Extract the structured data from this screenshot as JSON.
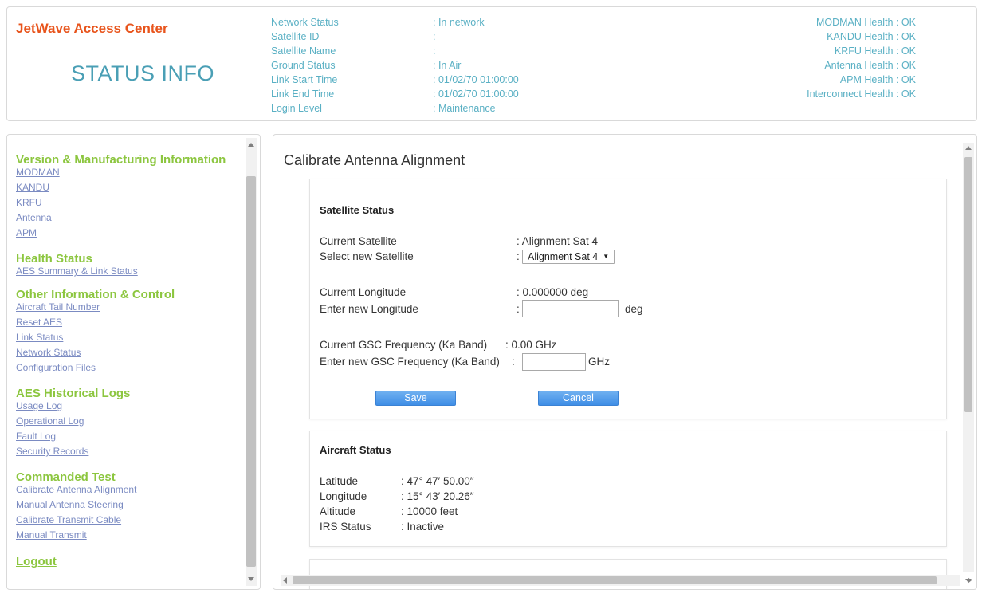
{
  "header": {
    "brand": "JetWave Access Center",
    "page_heading": "STATUS INFO",
    "network": [
      {
        "label": "Network Status",
        "value": ": In network"
      },
      {
        "label": "Satellite ID",
        "value": ":"
      },
      {
        "label": "Satellite Name",
        "value": ":"
      },
      {
        "label": "Ground Status",
        "value": ": In Air"
      },
      {
        "label": "Link Start Time",
        "value": ": 01/02/70 01:00:00"
      },
      {
        "label": "Link End Time",
        "value": ": 01/02/70 01:00:00"
      },
      {
        "label": "Login Level",
        "value": ": Maintenance"
      }
    ],
    "health": [
      "MODMAN Health : OK",
      "KANDU Health : OK",
      "KRFU Health : OK",
      "Antenna Health : OK",
      "APM Health : OK",
      "Interconnect Health : OK"
    ]
  },
  "sidebar": {
    "sections": [
      {
        "title": "Version & Manufacturing Information",
        "links": [
          "MODMAN",
          "KANDU",
          "KRFU",
          "Antenna",
          "APM"
        ]
      },
      {
        "title": "Health Status",
        "links": [
          "AES Summary & Link Status"
        ]
      },
      {
        "title": "Other Information & Control",
        "links": [
          "Aircraft Tail Number",
          "Reset AES",
          "Link Status",
          "Network Status",
          "Configuration Files"
        ]
      },
      {
        "title": "AES Historical Logs",
        "links": [
          "Usage Log",
          "Operational Log",
          "Fault Log",
          "Security Records"
        ]
      },
      {
        "title": "Commanded Test",
        "links": [
          "Calibrate Antenna Alignment",
          "Manual Antenna Steering",
          "Calibrate Transmit Cable",
          "Manual Transmit"
        ]
      }
    ],
    "logout": "Logout"
  },
  "main": {
    "title": "Calibrate Antenna Alignment",
    "satellite_status": {
      "title": "Satellite Status",
      "current_satellite_label": "Current Satellite",
      "current_satellite_value": ": Alignment Sat 4",
      "select_label": "Select new Satellite",
      "select_value": "Alignment Sat 4",
      "current_longitude_label": "Current Longitude",
      "current_longitude_value": ": 0.000000 deg",
      "enter_longitude_label": "Enter new Longitude",
      "longitude_unit": "deg",
      "current_gsc_label": "Current GSC Frequency (Ka Band)",
      "current_gsc_value": ": 0.00 GHz",
      "enter_gsc_label": "Enter new GSC Frequency (Ka Band)",
      "gsc_unit": "GHz",
      "colon": ":",
      "save": "Save",
      "cancel": "Cancel"
    },
    "aircraft_status": {
      "title": "Aircraft Status",
      "rows": [
        {
          "label": "Latitude",
          "value": ": 47° 47′ 50.00″"
        },
        {
          "label": "Longitude",
          "value": ": 15° 43′ 20.26″"
        },
        {
          "label": "Altitude",
          "value": ": 10000 feet"
        },
        {
          "label": "IRS Status",
          "value": ": Inactive"
        }
      ]
    }
  }
}
